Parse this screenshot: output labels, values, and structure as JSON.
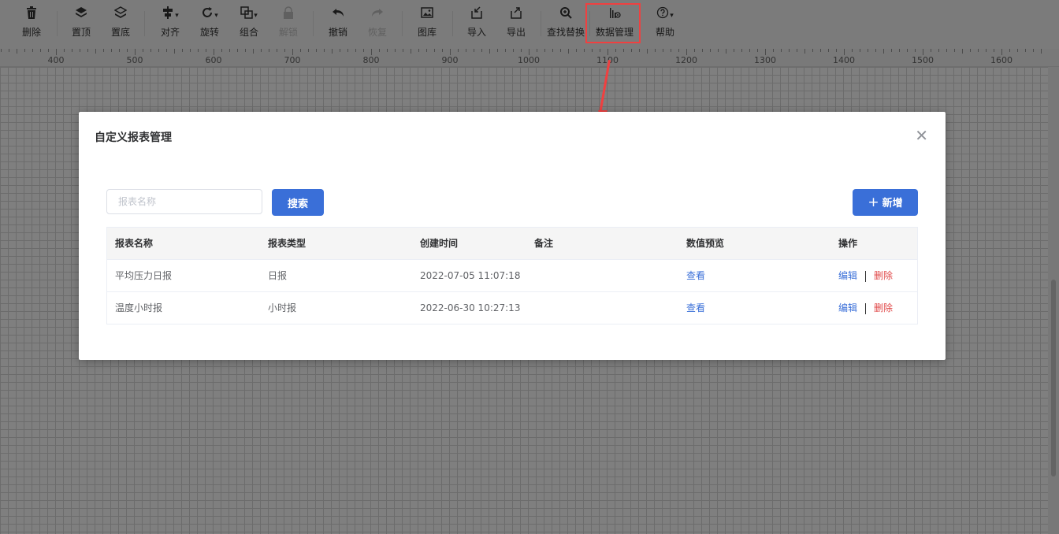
{
  "toolbar": {
    "items": [
      {
        "label": "删除",
        "icon": "trash-icon"
      },
      {
        "label": "置顶",
        "icon": "layers-top-icon"
      },
      {
        "label": "置底",
        "icon": "layers-bottom-icon"
      },
      {
        "label": "对齐",
        "icon": "align-icon"
      },
      {
        "label": "旋转",
        "icon": "rotate-icon"
      },
      {
        "label": "组合",
        "icon": "group-icon"
      },
      {
        "label": "解锁",
        "icon": "lock-icon"
      },
      {
        "label": "撤销",
        "icon": "undo-icon"
      },
      {
        "label": "恢复",
        "icon": "redo-icon"
      },
      {
        "label": "图库",
        "icon": "image-icon"
      },
      {
        "label": "导入",
        "icon": "import-icon"
      },
      {
        "label": "导出",
        "icon": "export-icon"
      },
      {
        "label": "查找替换",
        "icon": "search-zoom-icon"
      },
      {
        "label": "数据管理",
        "icon": "data-chart-icon"
      },
      {
        "label": "帮助",
        "icon": "help-icon"
      }
    ]
  },
  "ruler": {
    "labels": [
      "400",
      "500",
      "600",
      "700",
      "800",
      "900",
      "1000",
      "1100",
      "1200",
      "1300",
      "1400",
      "1500",
      "1600"
    ]
  },
  "dialog": {
    "title": "自定义报表管理",
    "close_glyph": "✕",
    "search": {
      "placeholder": "报表名称",
      "value": ""
    },
    "search_button": "搜索",
    "add_button": "新增",
    "add_glyph": "+",
    "table": {
      "headers": [
        "报表名称",
        "报表类型",
        "创建时间",
        "备注",
        "数值预览",
        "操作"
      ],
      "rows": [
        {
          "name": "平均压力日报",
          "type": "日报",
          "created": "2022-07-05 11:07:18",
          "note": "",
          "preview": "查看",
          "edit": "编辑",
          "delete": "删除"
        },
        {
          "name": "温度小时报",
          "type": "小时报",
          "created": "2022-06-30 10:27:13",
          "note": "",
          "preview": "查看",
          "edit": "编辑",
          "delete": "删除"
        }
      ]
    }
  },
  "colors": {
    "primary": "#3a6fd8",
    "danger": "#e04848",
    "highlight": "#f04040"
  }
}
